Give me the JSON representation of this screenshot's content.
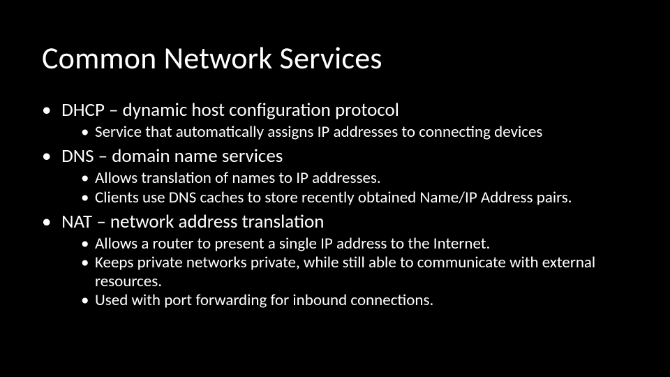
{
  "slide": {
    "title": "Common Network Services",
    "bullets": [
      {
        "text": "DHCP – dynamic host configuration protocol",
        "sub": [
          "Service that automatically assigns IP addresses to connecting devices"
        ]
      },
      {
        "text": "DNS – domain name services",
        "sub": [
          "Allows translation of names to IP addresses.",
          "Clients use DNS caches to store recently obtained Name/IP Address pairs."
        ]
      },
      {
        "text": "NAT – network address translation",
        "sub": [
          "Allows a router to present a single IP address to the Internet.",
          "Keeps private networks private, while still able to communicate with external resources.",
          "Used with port forwarding for inbound connections."
        ]
      }
    ]
  }
}
